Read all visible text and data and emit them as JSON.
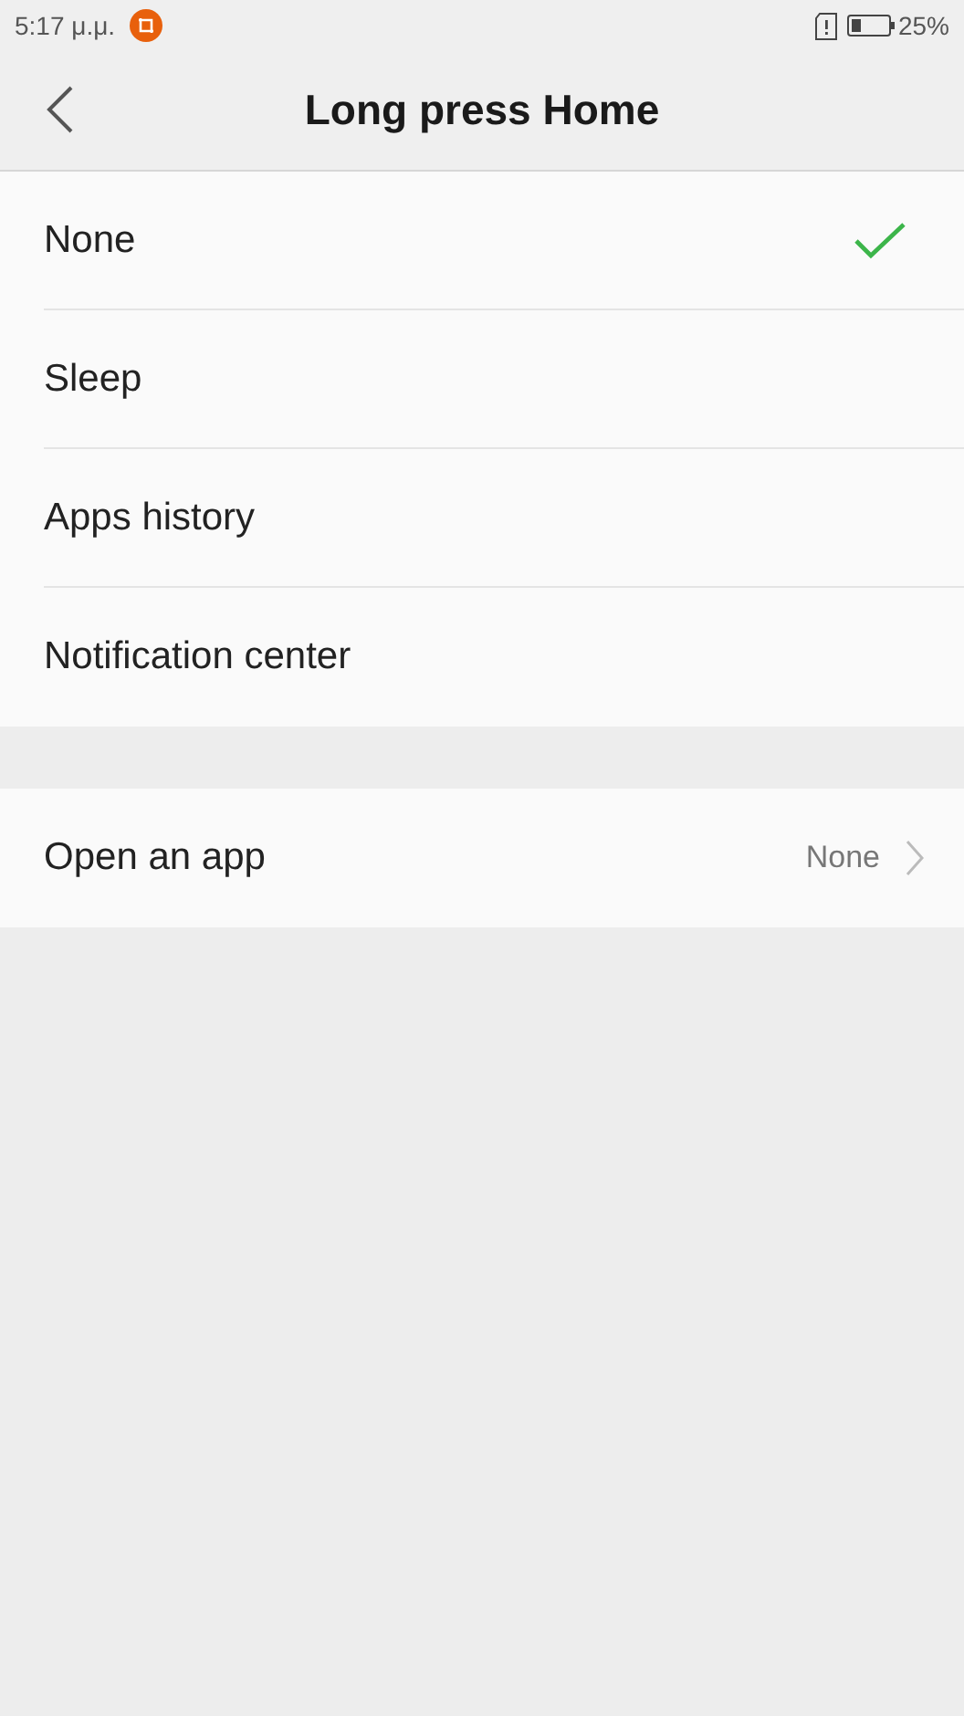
{
  "status_bar": {
    "time": "5:17 μ.μ.",
    "battery": "25%"
  },
  "header": {
    "title": "Long press Home"
  },
  "options": [
    {
      "label": "None",
      "selected": true
    },
    {
      "label": "Sleep",
      "selected": false
    },
    {
      "label": "Apps history",
      "selected": false
    },
    {
      "label": "Notification center",
      "selected": false
    }
  ],
  "open_app": {
    "label": "Open an app",
    "value": "None"
  }
}
